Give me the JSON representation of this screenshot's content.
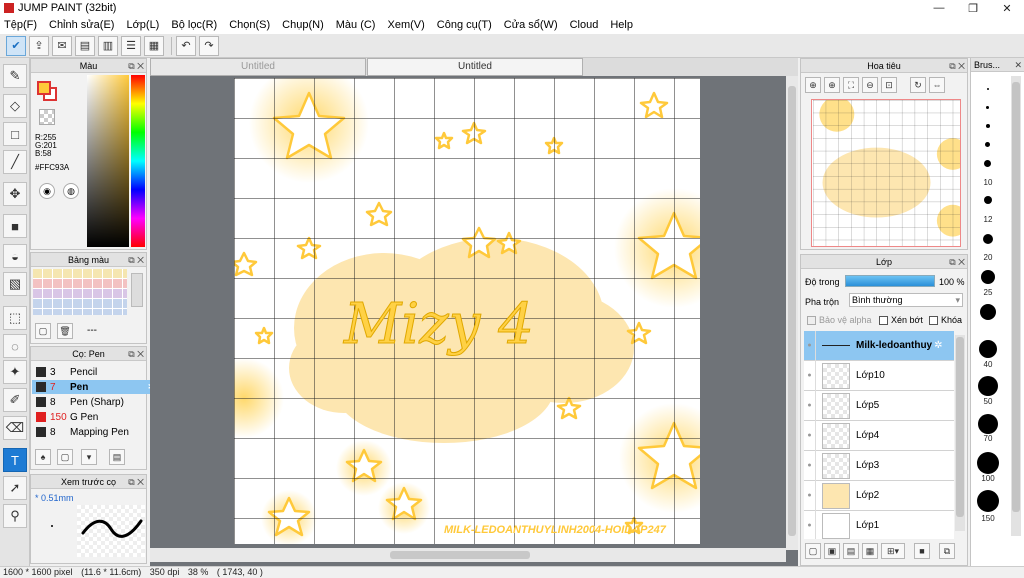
{
  "window": {
    "title": "JUMP PAINT (32bit)",
    "min": "—",
    "max": "❐",
    "close": "✕"
  },
  "menu": [
    "Tệp(F)",
    "Chỉnh sửa(E)",
    "Lớp(L)",
    "Bộ lọc(R)",
    "Chọn(S)",
    "Chụp(N)",
    "Màu (C)",
    "Xem(V)",
    "Công cụ(T)",
    "Cửa sổ(W)",
    "Cloud",
    "Help"
  ],
  "tabs": [
    {
      "label": "Untitled",
      "active": false
    },
    {
      "label": "Untitled",
      "active": true
    }
  ],
  "color_panel": {
    "title": "Màu",
    "r": "R:255",
    "g": "G:201",
    "b": "B:58",
    "hex": "#FFC93A",
    "current_color": "#ffc93a"
  },
  "palette_panel": {
    "title": "Bảng màu",
    "placeholder": "---"
  },
  "brush_panel": {
    "title": "Cọ: Pen",
    "brushes": [
      {
        "size": "3",
        "name": "Pencil",
        "color": "#2a2a2a"
      },
      {
        "size": "7",
        "name": "Pen",
        "color": "#e02020",
        "selected": true
      },
      {
        "size": "8",
        "name": "Pen (Sharp)",
        "color": "#2a2a2a"
      },
      {
        "size": "150",
        "name": "G Pen",
        "color": "#e02020"
      },
      {
        "size": "8",
        "name": "Mapping Pen",
        "color": "#2a2a2a"
      }
    ]
  },
  "preview_panel": {
    "title": "Xem trước cọ",
    "size_label": "* 0.51mm"
  },
  "canvas": {
    "handwriting": "Mizy 4",
    "watermark": "MILK-LEDOANTHUYLINH2004-HOIDAP247"
  },
  "navigator": {
    "title": "Hoa tiêu"
  },
  "layers": {
    "title": "Lớp",
    "opacity_label": "Độ trong",
    "opacity_value": "100 %",
    "opacity_fraction": 1.0,
    "blend_label": "Pha trộn",
    "blend_value": "Bình thường",
    "protect_alpha": "Bảo vệ alpha",
    "clip": "Xén bớt",
    "lock": "Khóa",
    "items": [
      {
        "name": "Milk-ledoanthuy",
        "selected": true,
        "text_layer": true
      },
      {
        "name": "Lớp10"
      },
      {
        "name": "Lớp5"
      },
      {
        "name": "Lớp4"
      },
      {
        "name": "Lớp3"
      },
      {
        "name": "Lớp2"
      },
      {
        "name": "Lớp1"
      }
    ]
  },
  "brush_sizes": {
    "title": "Brus...",
    "labels": [
      "10",
      "12",
      "20",
      "25",
      "40",
      "50",
      "70",
      "100",
      "150"
    ]
  },
  "status": {
    "size": "1600 * 1600 pixel",
    "cm": "(11.6 * 11.6cm)",
    "dpi": "350 dpi",
    "zoom": "38 %",
    "coords": "( 1743, 40 )"
  }
}
